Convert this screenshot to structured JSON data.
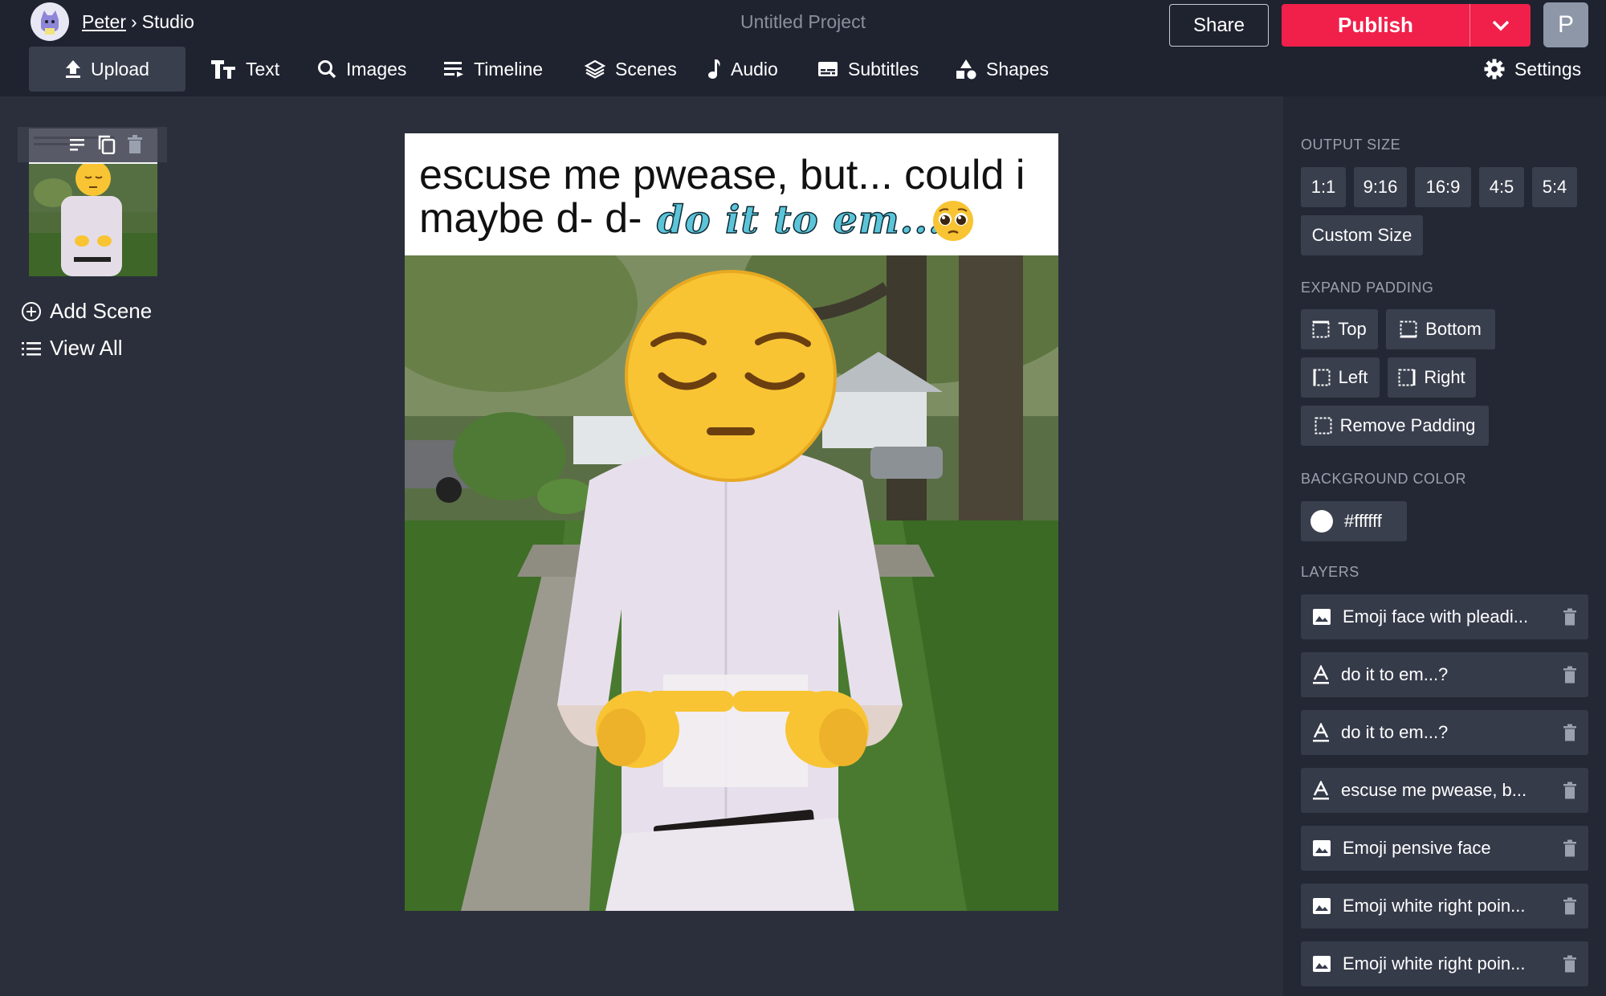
{
  "header": {
    "user": "Peter",
    "separator": "›",
    "section": "Studio",
    "project_title": "Untitled Project",
    "share_label": "Share",
    "publish_label": "Publish",
    "account_initial": "P"
  },
  "toolbar": {
    "upload": "Upload",
    "text": "Text",
    "images": "Images",
    "timeline": "Timeline",
    "scenes": "Scenes",
    "audio": "Audio",
    "subtitles": "Subtitles",
    "shapes": "Shapes",
    "settings": "Settings"
  },
  "scenes_panel": {
    "add_scene": "Add Scene",
    "view_all": "View All"
  },
  "canvas": {
    "caption_line1": "escuse me pwease, but... could i",
    "caption_line2": "maybe d- d-",
    "caption_script": "do it to em...?"
  },
  "right_panel": {
    "output_size_label": "OUTPUT SIZE",
    "sizes": [
      "1:1",
      "9:16",
      "16:9",
      "4:5",
      "5:4"
    ],
    "custom_size": "Custom Size",
    "expand_padding_label": "EXPAND PADDING",
    "padding": {
      "top": "Top",
      "bottom": "Bottom",
      "left": "Left",
      "right": "Right",
      "remove": "Remove Padding"
    },
    "background_color_label": "BACKGROUND COLOR",
    "background_color_value": "#ffffff",
    "swatches": [
      "#000000",
      "#ffffff",
      "#f0204a",
      "#ffe600",
      "#1e90ff",
      "none"
    ],
    "layers_label": "LAYERS",
    "layers": [
      {
        "type": "image",
        "name": "Emoji face with pleadi..."
      },
      {
        "type": "text",
        "name": "do it to em...?"
      },
      {
        "type": "text",
        "name": "do it to em...?"
      },
      {
        "type": "text",
        "name": "escuse me pwease, b..."
      },
      {
        "type": "image",
        "name": "Emoji pensive face"
      },
      {
        "type": "image",
        "name": "Emoji white right poin..."
      },
      {
        "type": "image",
        "name": "Emoji white right poin..."
      }
    ]
  },
  "colors": {
    "accent": "#f0204a",
    "topbar": "#1f2330",
    "workspace": "#2b2f3b",
    "panel": "#242834"
  }
}
